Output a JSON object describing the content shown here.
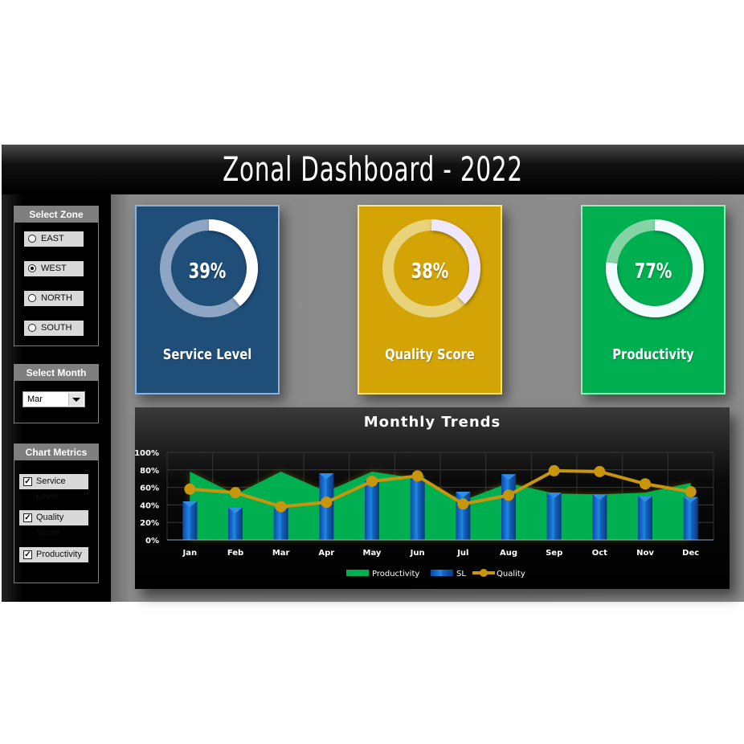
{
  "header": {
    "title": "Zonal Dashboard - 2022"
  },
  "sidebar": {
    "zone": {
      "heading": "Select Zone",
      "options": [
        {
          "label": "EAST",
          "selected": false
        },
        {
          "label": "WEST",
          "selected": true
        },
        {
          "label": "NORTH",
          "selected": false
        },
        {
          "label": "SOUTH",
          "selected": false
        }
      ]
    },
    "month": {
      "heading": "Select Month",
      "selected": "Mar"
    },
    "metrics": {
      "heading": "Chart Metrics",
      "items": [
        {
          "label": "Service Level",
          "checked": true
        },
        {
          "label": "Quality Score",
          "checked": true
        },
        {
          "label": "Productivity",
          "checked": true
        }
      ]
    }
  },
  "kpis": [
    {
      "label": "Service Level",
      "value_text": "39%",
      "value": 0.39,
      "color": "#1f4e79",
      "border": "#8fb0d8",
      "track": "#8ea6c4",
      "fill": "#ffffff"
    },
    {
      "label": "Quality Score",
      "value_text": "38%",
      "value": 0.38,
      "color": "#d4a406",
      "border": "#ffe680",
      "track": "#e8d27a",
      "fill": "#efe6ff"
    },
    {
      "label": "Productivity",
      "value_text": "77%",
      "value": 0.77,
      "color": "#00b050",
      "border": "#8ff0b8",
      "track": "#86d4a6",
      "fill": "#f2fbff"
    }
  ],
  "chart_data": {
    "type": "bar",
    "title": "Monthly Trends",
    "xlabel": "",
    "ylabel": "",
    "ylim": [
      0,
      1
    ],
    "yticks": [
      "0%",
      "20%",
      "40%",
      "60%",
      "80%",
      "100%"
    ],
    "grid": true,
    "legend": "bottom",
    "categories": [
      "Jan",
      "Feb",
      "Mar",
      "Apr",
      "May",
      "Jun",
      "Jul",
      "Aug",
      "Sep",
      "Oct",
      "Nov",
      "Dec"
    ],
    "series": [
      {
        "name": "Productivity",
        "type": "area",
        "color": "#00b050",
        "values": [
          0.78,
          0.52,
          0.78,
          0.55,
          0.78,
          0.7,
          0.45,
          0.65,
          0.53,
          0.52,
          0.54,
          0.65
        ]
      },
      {
        "name": "SL",
        "type": "bar",
        "color": "#1565c0",
        "values": [
          0.44,
          0.37,
          0.37,
          0.76,
          0.68,
          0.73,
          0.55,
          0.75,
          0.54,
          0.52,
          0.5,
          0.49
        ]
      },
      {
        "name": "Quality",
        "type": "line",
        "color": "#c8960c",
        "values": [
          0.58,
          0.54,
          0.38,
          0.43,
          0.67,
          0.73,
          0.41,
          0.51,
          0.79,
          0.78,
          0.64,
          0.55
        ]
      }
    ]
  }
}
